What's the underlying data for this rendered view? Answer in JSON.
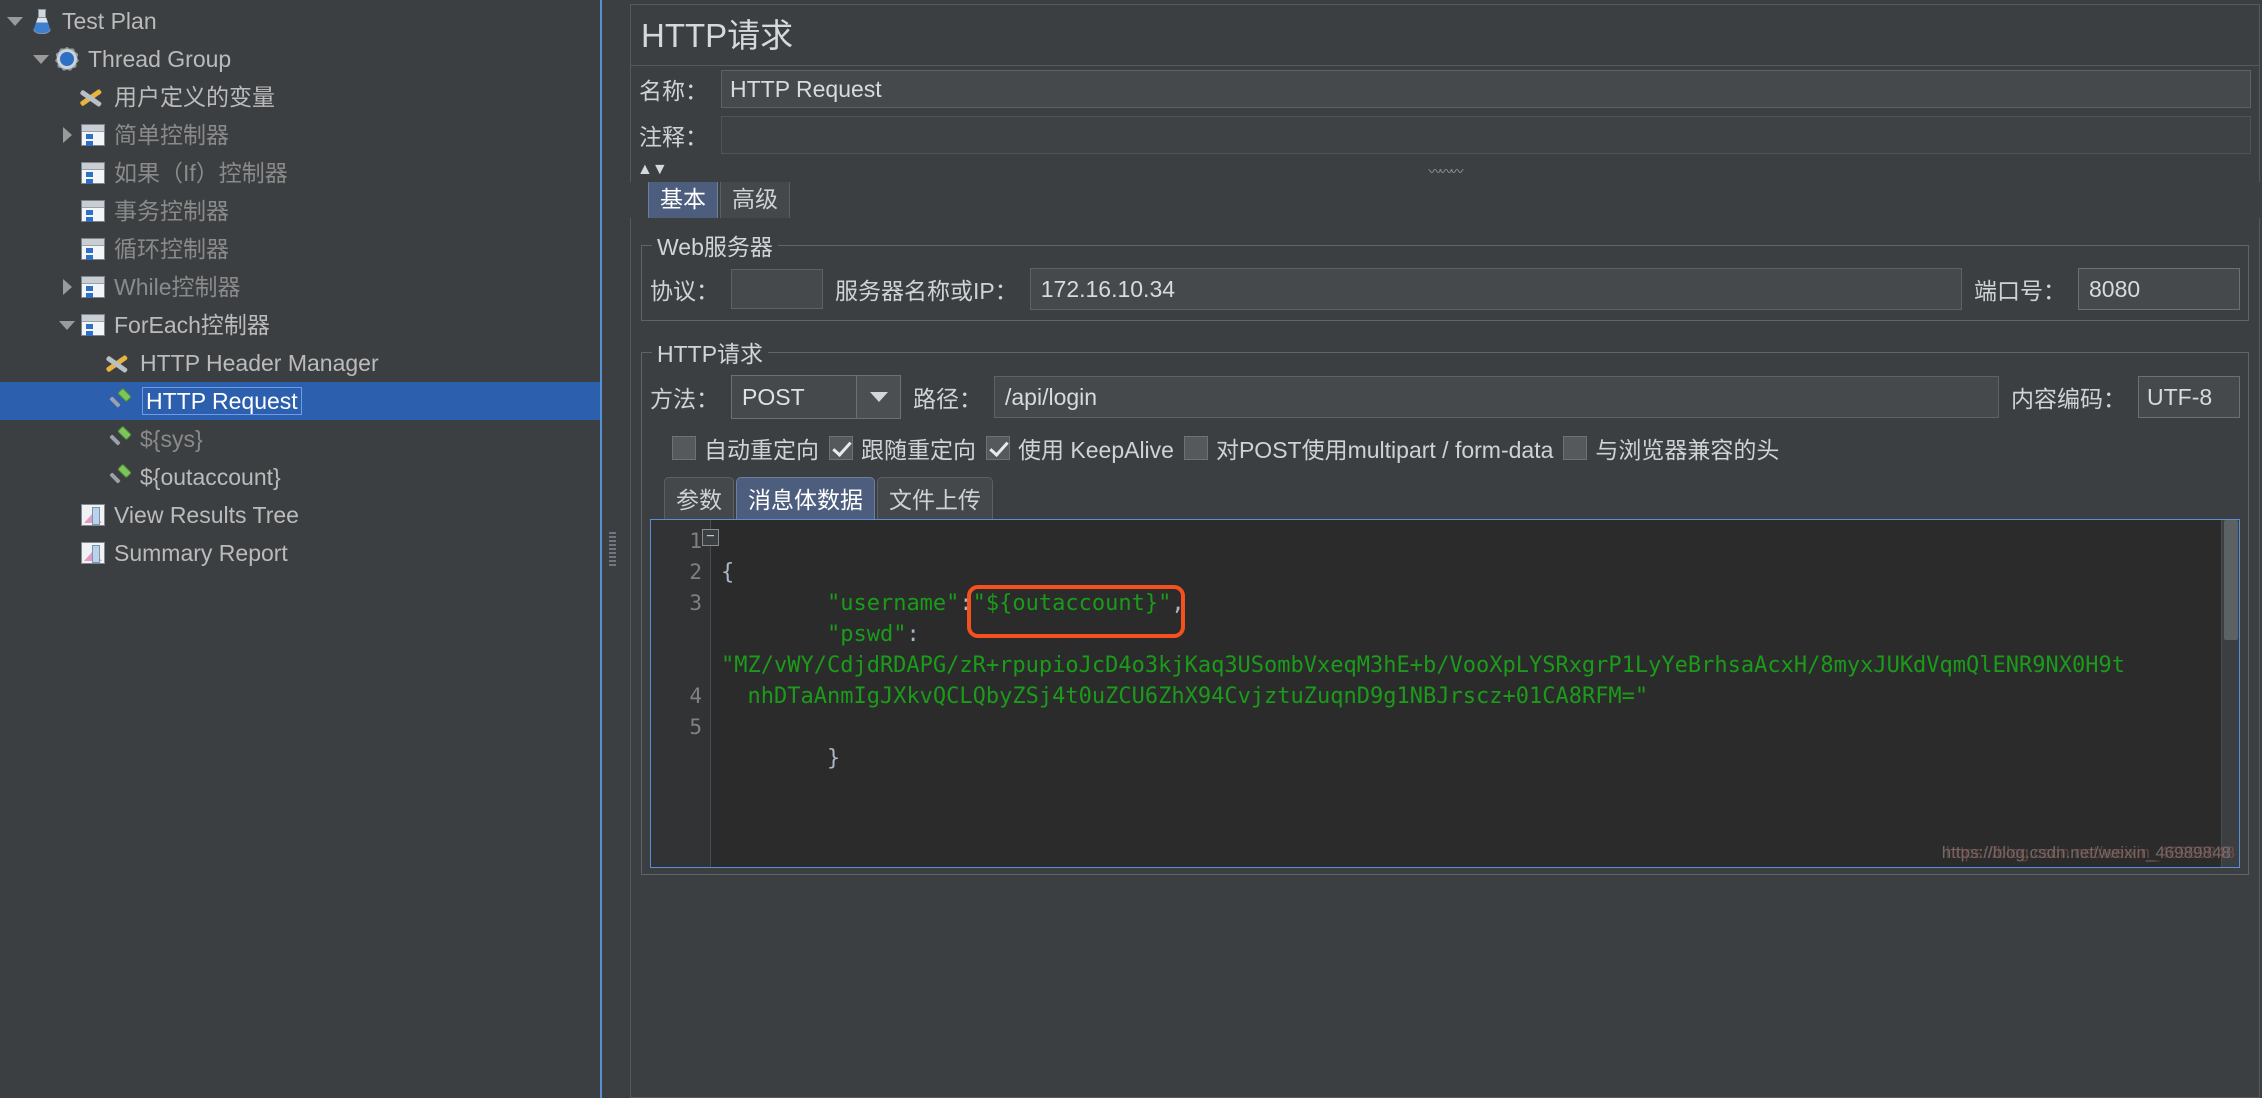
{
  "tree": {
    "items": [
      {
        "label": "Test Plan",
        "icon": "flask-icon",
        "indent": 0,
        "toggle": "down",
        "dim": false,
        "selected": false
      },
      {
        "label": "Thread Group",
        "icon": "gear-icon",
        "indent": 1,
        "toggle": "down",
        "dim": false,
        "selected": false
      },
      {
        "label": "用户定义的变量",
        "icon": "tools-icon",
        "indent": 2,
        "toggle": "none",
        "dim": false,
        "selected": false
      },
      {
        "label": "简单控制器",
        "icon": "controller-icon",
        "indent": 2,
        "toggle": "right",
        "dim": true,
        "selected": false
      },
      {
        "label": "如果（If）控制器",
        "icon": "controller-icon",
        "indent": 2,
        "toggle": "none",
        "dim": true,
        "selected": false
      },
      {
        "label": "事务控制器",
        "icon": "controller-icon",
        "indent": 2,
        "toggle": "none",
        "dim": true,
        "selected": false
      },
      {
        "label": "循环控制器",
        "icon": "controller-icon",
        "indent": 2,
        "toggle": "none",
        "dim": true,
        "selected": false
      },
      {
        "label": "While控制器",
        "icon": "controller-icon",
        "indent": 2,
        "toggle": "right",
        "dim": true,
        "selected": false
      },
      {
        "label": "ForEach控制器",
        "icon": "controller-icon",
        "indent": 2,
        "toggle": "down",
        "dim": false,
        "selected": false
      },
      {
        "label": "HTTP Header Manager",
        "icon": "tools-icon",
        "indent": 3,
        "toggle": "none",
        "dim": false,
        "selected": false
      },
      {
        "label": "HTTP Request",
        "icon": "pipette-icon",
        "indent": 3,
        "toggle": "none",
        "dim": false,
        "selected": true
      },
      {
        "label": "${sys}",
        "icon": "pipette-icon",
        "indent": 3,
        "toggle": "none",
        "dim": true,
        "selected": false
      },
      {
        "label": "${outaccount}",
        "icon": "pipette-icon",
        "indent": 3,
        "toggle": "none",
        "dim": false,
        "selected": false
      },
      {
        "label": "View Results Tree",
        "icon": "chart-icon",
        "indent": 2,
        "toggle": "none",
        "dim": false,
        "selected": false
      },
      {
        "label": "Summary Report",
        "icon": "chart-icon",
        "indent": 2,
        "toggle": "none",
        "dim": false,
        "selected": false
      }
    ]
  },
  "panel": {
    "title": "HTTP请求",
    "name_label": "名称：",
    "name_value": "HTTP Request",
    "comment_label": "注释：",
    "comment_value": "",
    "sort_arrows": "▲▼",
    "zigzag": "〰〰〰"
  },
  "tabs": {
    "basic": "基本",
    "advanced": "高级"
  },
  "web_server": {
    "legend": "Web服务器",
    "protocol_label": "协议：",
    "protocol_value": "",
    "server_label": "服务器名称或IP：",
    "server_value": "172.16.10.34",
    "port_label": "端口号：",
    "port_value": "8080"
  },
  "http_request": {
    "legend": "HTTP请求",
    "method_label": "方法：",
    "method_value": "POST",
    "path_label": "路径：",
    "path_value": "/api/login",
    "encoding_label": "内容编码：",
    "encoding_value": "UTF-8"
  },
  "checkboxes": [
    {
      "label": "自动重定向",
      "checked": false
    },
    {
      "label": "跟随重定向",
      "checked": true
    },
    {
      "label": "使用 KeepAlive",
      "checked": true
    },
    {
      "label": "对POST使用multipart / form-data",
      "checked": false
    },
    {
      "label": "与浏览器兼容的头",
      "checked": false
    }
  ],
  "body_tabs": {
    "params": "参数",
    "body_data": "消息体数据",
    "file_upload": "文件上传"
  },
  "editor": {
    "line_numbers": [
      "1",
      "2",
      "3",
      "4",
      "5"
    ],
    "fold_glyph": "−",
    "line1": "{",
    "line2_key": "\"username\"",
    "line2_colon": ":",
    "line2_value": "\"${outaccount}\"",
    "line2_comma": ",",
    "line3_key": "\"pswd\"",
    "line3_colon": ":",
    "line3_value_part1": "\"MZ/vWY/CdjdRDAPG/zR+rpupioJcD4o3kjKaq3USombVxeqM3hE+b/VooXpLYSRxgrP1LyYeBrhsaAcxH/8myxJUKdVqmQlENR9NX0H9t",
    "line3_value_part2": "nhDTaAnmIgJXkvQCLQbyZSj4t0uZCU6ZhX94CvjztuZuqnD9g1NBJrscz+01CA8RFM=\"",
    "line5": "}"
  },
  "watermark": {
    "text_gray": "https://blog.csdn.net/weixin_46989848",
    "text_red": "https://blog.csdn.net/weixin_46989848"
  },
  "colors": {
    "selection_blue": "#2d5faf",
    "accent_blue": "#5a8fd6",
    "code_green": "#1a9c1a",
    "highlight_orange": "#f4511e",
    "panel_bg": "#3c3f41",
    "editor_bg": "#2b2b2b"
  }
}
